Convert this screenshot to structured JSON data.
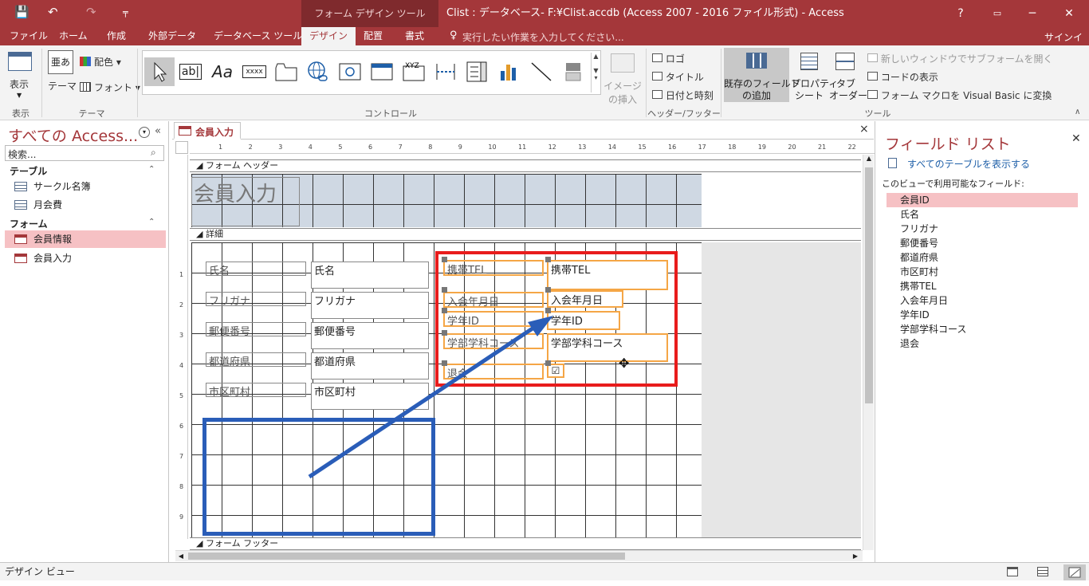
{
  "window": {
    "title": "Clist : データベース- F:¥Clist.accdb (Access 2007 - 2016 ファイル形式) - Access",
    "context_tab": "フォーム デザイン ツール",
    "help": "?",
    "minimize": "─",
    "restore": "❐",
    "close": "✕"
  },
  "qat": {
    "save": "💾",
    "undo": "↶",
    "redo": "↷",
    "more": "╤"
  },
  "menu": {
    "tabs": [
      "ファイル",
      "ホーム",
      "作成",
      "外部データ",
      "データベース ツール",
      "デザイン",
      "配置",
      "書式"
    ],
    "active": "デザイン",
    "tellme": "実行したい作業を入力してください...",
    "signin": "サインイン"
  },
  "ribbon": {
    "view": {
      "label": "表示",
      "group": "表示"
    },
    "theme": {
      "theme_label": "テーマ",
      "colors_label": "配色",
      "fonts_label": "フォント",
      "group": "テーマ",
      "theme_glyph": "亜あ"
    },
    "controls": {
      "group": "コントロール",
      "textbox_glyph": "ab|",
      "label_glyph": "Aa",
      "button_glyph": "xxxx",
      "option_glyph": "XYZ"
    },
    "image": {
      "label1": "イメージ",
      "label2": "の挿入"
    },
    "header_footer": {
      "logo": "ロゴ",
      "title": "タイトル",
      "datetime": "日付と時刻",
      "group": "ヘッダー/フッター"
    },
    "tools": {
      "add_fields1": "既存のフィールド",
      "add_fields2": "の追加",
      "property1": "プロパティ",
      "property2": "シート",
      "tab1": "タブ",
      "tab2": "オーダー",
      "subform": "新しいウィンドウでサブフォームを開く",
      "code": "コードの表示",
      "macro": "フォーム マクロを Visual Basic に変換",
      "group": "ツール"
    }
  },
  "nav": {
    "title": "すべての Access...",
    "search_placeholder": "検索...",
    "groups": [
      {
        "name": "テーブル",
        "items": [
          "サークル名簿",
          "月会費"
        ]
      },
      {
        "name": "フォーム",
        "items": [
          "会員情報",
          "会員入力"
        ]
      }
    ],
    "selected": "会員情報"
  },
  "document": {
    "tab": "会員入力",
    "close": "×",
    "ruler": [
      "1",
      "2",
      "3",
      "4",
      "5",
      "6",
      "7",
      "8",
      "9",
      "10",
      "11",
      "12",
      "13",
      "14",
      "15",
      "16",
      "17",
      "18",
      "19",
      "20",
      "21",
      "22"
    ],
    "vruler": [
      "1",
      "2",
      "3",
      "4",
      "5",
      "6",
      "7",
      "8",
      "9"
    ],
    "sections": {
      "header": "フォーム ヘッダー",
      "detail": "詳細",
      "footer": "フォーム フッター"
    },
    "header_title": "会員入力",
    "left_labels": [
      "氏名",
      "フリガナ",
      "郵便番号",
      "都道府県",
      "市区町村"
    ],
    "left_fields": [
      "氏名",
      "フリガナ",
      "郵便番号",
      "都道府県",
      "市区町村"
    ],
    "right_labels": [
      "携帯TEL",
      "入会年月日",
      "学年ID",
      "学部学科コース",
      "退会"
    ],
    "right_fields": [
      "携帯TEL",
      "入会年月日",
      "学年ID",
      "学部学科コース"
    ],
    "checkbox": "☑"
  },
  "field_list": {
    "title": "フィールド リスト",
    "show_all": "すべてのテーブルを表示する",
    "available": "このビューで利用可能なフィールド:",
    "fields": [
      "会員ID",
      "氏名",
      "フリガナ",
      "郵便番号",
      "都道府県",
      "市区町村",
      "携帯TEL",
      "入会年月日",
      "学年ID",
      "学部学科コース",
      "退会"
    ],
    "selected": "会員ID",
    "close": "✕"
  },
  "status": {
    "text": "デザイン ビュー"
  },
  "colors": {
    "accent": "#a4373a",
    "annotation_red": "#e81c1c",
    "annotation_blue": "#2a5db8",
    "selection": "#f5a646"
  }
}
